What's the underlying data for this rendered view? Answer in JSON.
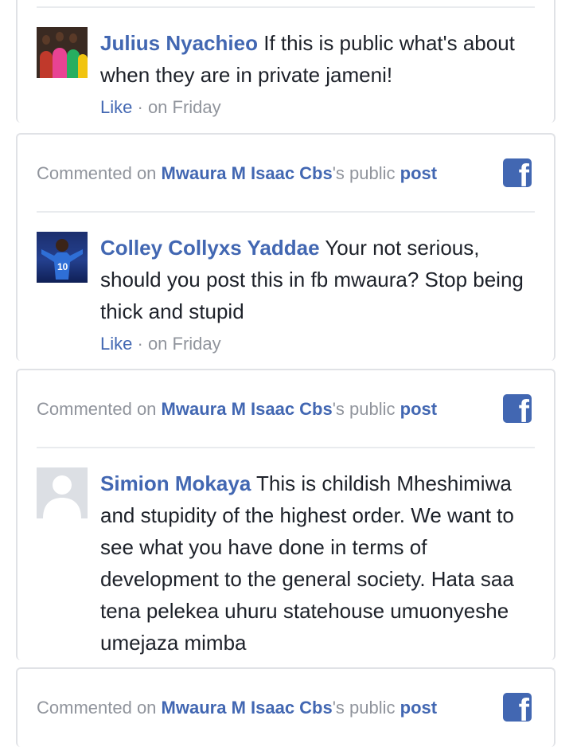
{
  "comments": [
    {
      "author": "Julius Nyachieo",
      "text": "If this is public what's about when they are in private jameni!",
      "like_label": "Like",
      "time": "on Friday"
    },
    {
      "header": {
        "prefix": "Commented on",
        "page_name": "Mwaura M Isaac Cbs",
        "middle": "'s public",
        "post_link": "post"
      },
      "author": "Colley Collyxs Yaddae",
      "text": "Your not serious, should you post this in fb mwaura? Stop being thick and stupid",
      "like_label": "Like",
      "time": "on Friday"
    },
    {
      "header": {
        "prefix": "Commented on",
        "page_name": "Mwaura M Isaac Cbs",
        "middle": "'s public",
        "post_link": "post"
      },
      "author": "Simion Mokaya",
      "text": "This is childish Mheshimiwa and stupidity of the highest order. We want to see what you have done in terms of development to the general society. Hata saa tena pelekea uhuru statehouse umuonyeshe umejaza mimba"
    },
    {
      "header": {
        "prefix": "Commented on",
        "page_name": "Mwaura M Isaac Cbs",
        "middle": "'s public",
        "post_link": "post"
      }
    }
  ],
  "icons": {
    "facebook": "facebook-icon",
    "facebook_glyph": "f"
  },
  "colors": {
    "link": "#4267b2",
    "muted": "#90949c",
    "text": "#1d2129",
    "border": "#e0e2e6"
  }
}
